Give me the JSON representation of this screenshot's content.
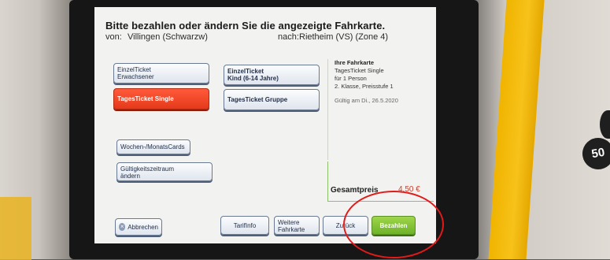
{
  "screen": {
    "title": "Bitte bezahlen oder ändern Sie die angezeigte Fahrkarte.",
    "from_label": "von:",
    "from_value": "Villingen (Schwarzw)",
    "to_label": "nach:",
    "to_value": "Rietheim (VS) (Zone 4)"
  },
  "tickets": {
    "einzel_erwachsener": [
      "EinzelTicket",
      "Erwachsener"
    ],
    "einzel_kind": [
      "EinzelTicket",
      "Kind (6-14 Jahre)"
    ],
    "tages_single": "TagesTicket Single",
    "tages_gruppe": "TagesTicket Gruppe",
    "wochen_monats": "Wochen-/MonatsCards",
    "gueltigkeit": [
      "Gültigkeitszeitraum",
      "ändern"
    ]
  },
  "info": {
    "heading": "Ihre Fahrkarte",
    "line1": "TagesTicket Single",
    "line2": "für 1 Person",
    "line3": "2. Klasse, Preisstufe 1",
    "validity": "Gültig am Di., 26.5.2020"
  },
  "total": {
    "label": "Gesamtpreis",
    "value": "4,50 €"
  },
  "bottom": {
    "cancel": "Abbrechen",
    "tarifinfo": "TarifInfo",
    "weitere": [
      "Weitere",
      "Fahrkarte"
    ],
    "zurueck": "Zurück",
    "bezahlen": "Bezahlen"
  },
  "machine": {
    "side_label": "50"
  },
  "colors": {
    "selected": "#e43a1b",
    "pay": "#6eb22a",
    "annotation_circle": "#e11a1a"
  }
}
